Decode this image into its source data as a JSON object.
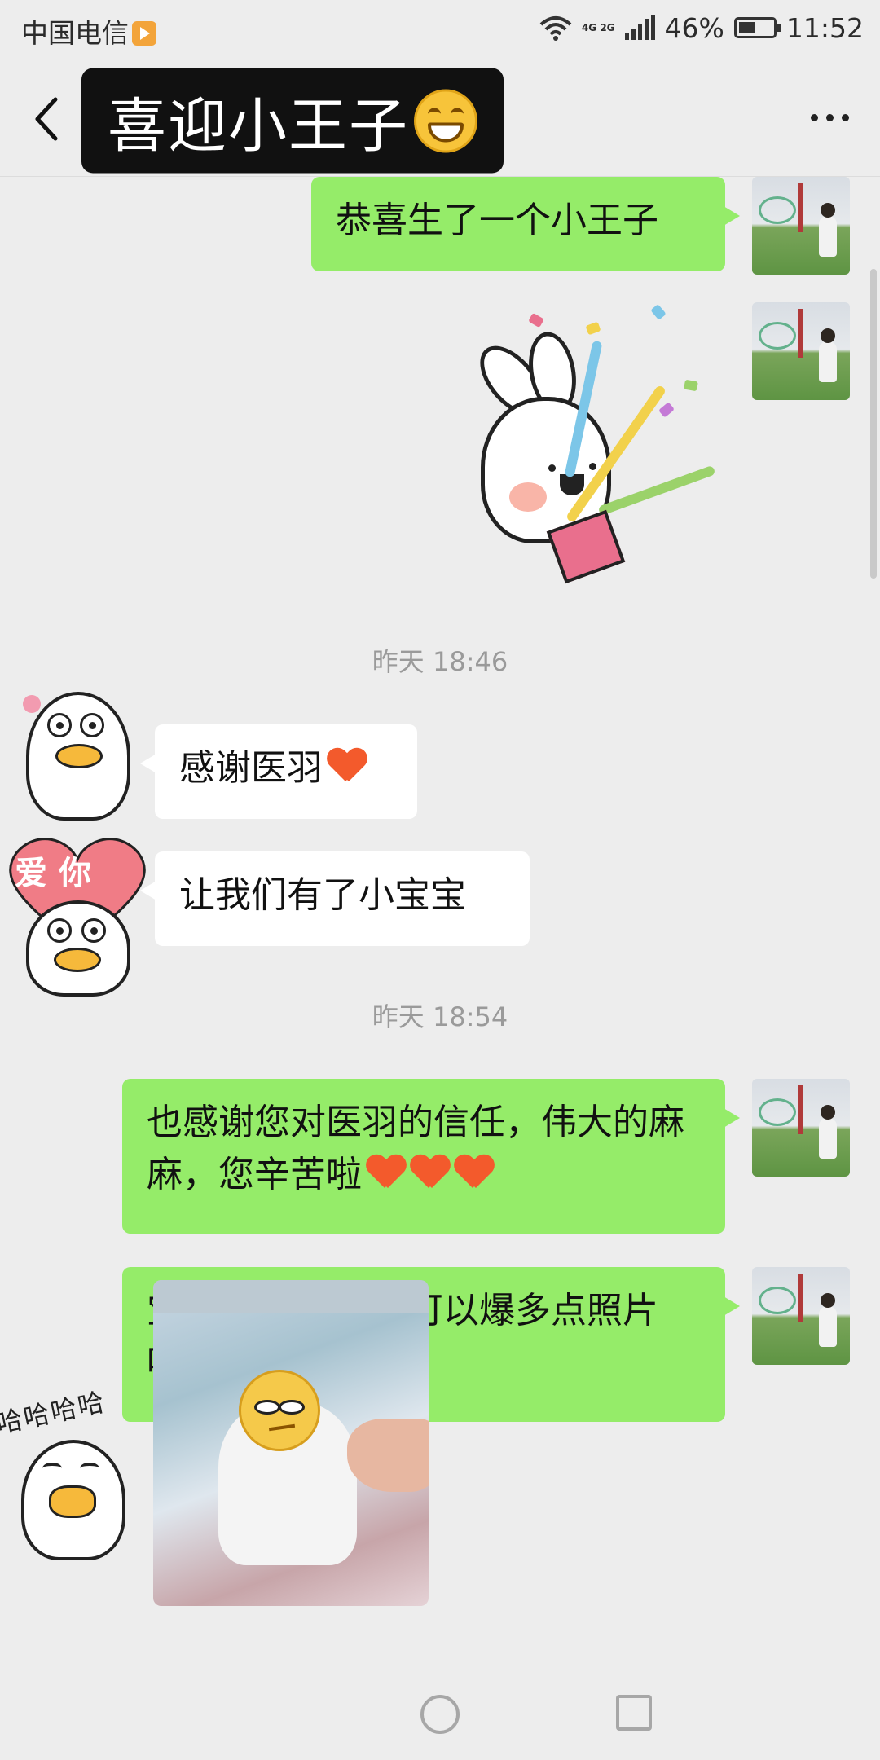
{
  "status_bar": {
    "carrier": "中国电信",
    "network": "4G 2G",
    "battery": "46%",
    "time": "11:52",
    "battery_level": 0.46
  },
  "nav": {
    "title": "喜迎小王子",
    "title_emoji": "grinning-face-icon",
    "back_icon": "chevron-left-icon",
    "more_icon": "more-dots-icon"
  },
  "messages": [
    {
      "side": "me",
      "text": "恭喜生了一个小王子"
    },
    {
      "side": "me",
      "type": "sticker",
      "sticker": "celebrating-bunny-sticker"
    },
    {
      "type": "time",
      "text": "昨天 18:46"
    },
    {
      "side": "them",
      "text": "感谢医羽",
      "emoji": "orange-heart"
    },
    {
      "side": "them",
      "text": "让我们有了小宝宝"
    },
    {
      "type": "time",
      "text": "昨天 18:54"
    },
    {
      "side": "me",
      "text": "也感谢您对医羽的信任，伟大的麻麻，您辛苦啦",
      "emoji": "orange-heart x3"
    },
    {
      "side": "me",
      "text": "宝宝是 6 斤吗？可以爆多点照片吗？",
      "emoji": "smiling-face x2"
    },
    {
      "side": "them",
      "type": "image",
      "image": "newborn-baby-photo"
    }
  ],
  "stickers": {
    "duck_love_text": "爱你",
    "duck_laugh_text": "哈哈哈哈"
  }
}
